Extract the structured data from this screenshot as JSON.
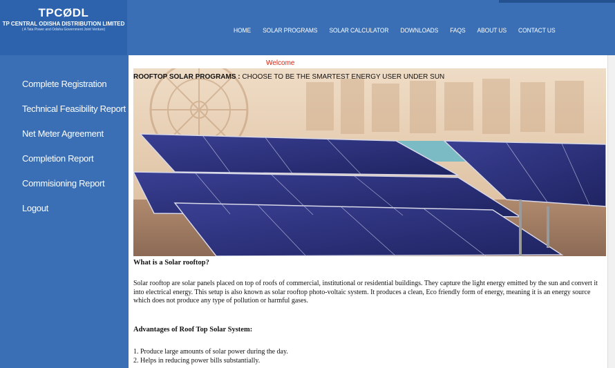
{
  "logo": {
    "name": "TPCØDL",
    "company": "TP CENTRAL ODISHA DISTRIBUTION LIMITED",
    "tagline": "( A Tata Power and Odisha Government Joint Venture)"
  },
  "nav": {
    "items": [
      "HOME",
      "SOLAR PROGRAMS",
      "SOLAR CALCULATOR",
      "DOWNLOADS",
      "FAQS",
      "ABOUT US",
      "CONTACT US"
    ]
  },
  "sidebar": {
    "items": [
      "Complete Registration",
      "Technical Feasibility Report",
      "Net Meter Agreement",
      "Completion Report",
      "Commisioning Report",
      "Logout"
    ]
  },
  "main": {
    "welcome": "Welcome",
    "banner_title_bold": "ROOFTOP SOLAR PROGRAMS :",
    "banner_title_rest": " CHOOSE TO BE THE SMARTEST ENERGY USER UNDER SUN",
    "what_heading": "What is a Solar rooftop?",
    "what_text": "Solar rooftop are solar panels placed on top of roofs of commercial, institutional or residential buildings. They capture the light energy emitted by the sun and convert it into electrical energy. This setup is also known as solar rooftop photo-voltaic system. It produces a clean, Eco friendly form of energy, meaning it is an energy source which does not produce any type of pollution or harmful gases.",
    "adv_heading": "Advantages of Roof Top Solar System:",
    "adv_items": [
      "1. Produce large amounts of solar power during the day.",
      "2. Helps in reducing power bills substantially."
    ]
  },
  "colors": {
    "header_blue": "#3a6fb5",
    "logo_blue": "#2d63ad",
    "welcome_red": "#d9230f",
    "panel_blue": "#2a2f7a"
  }
}
